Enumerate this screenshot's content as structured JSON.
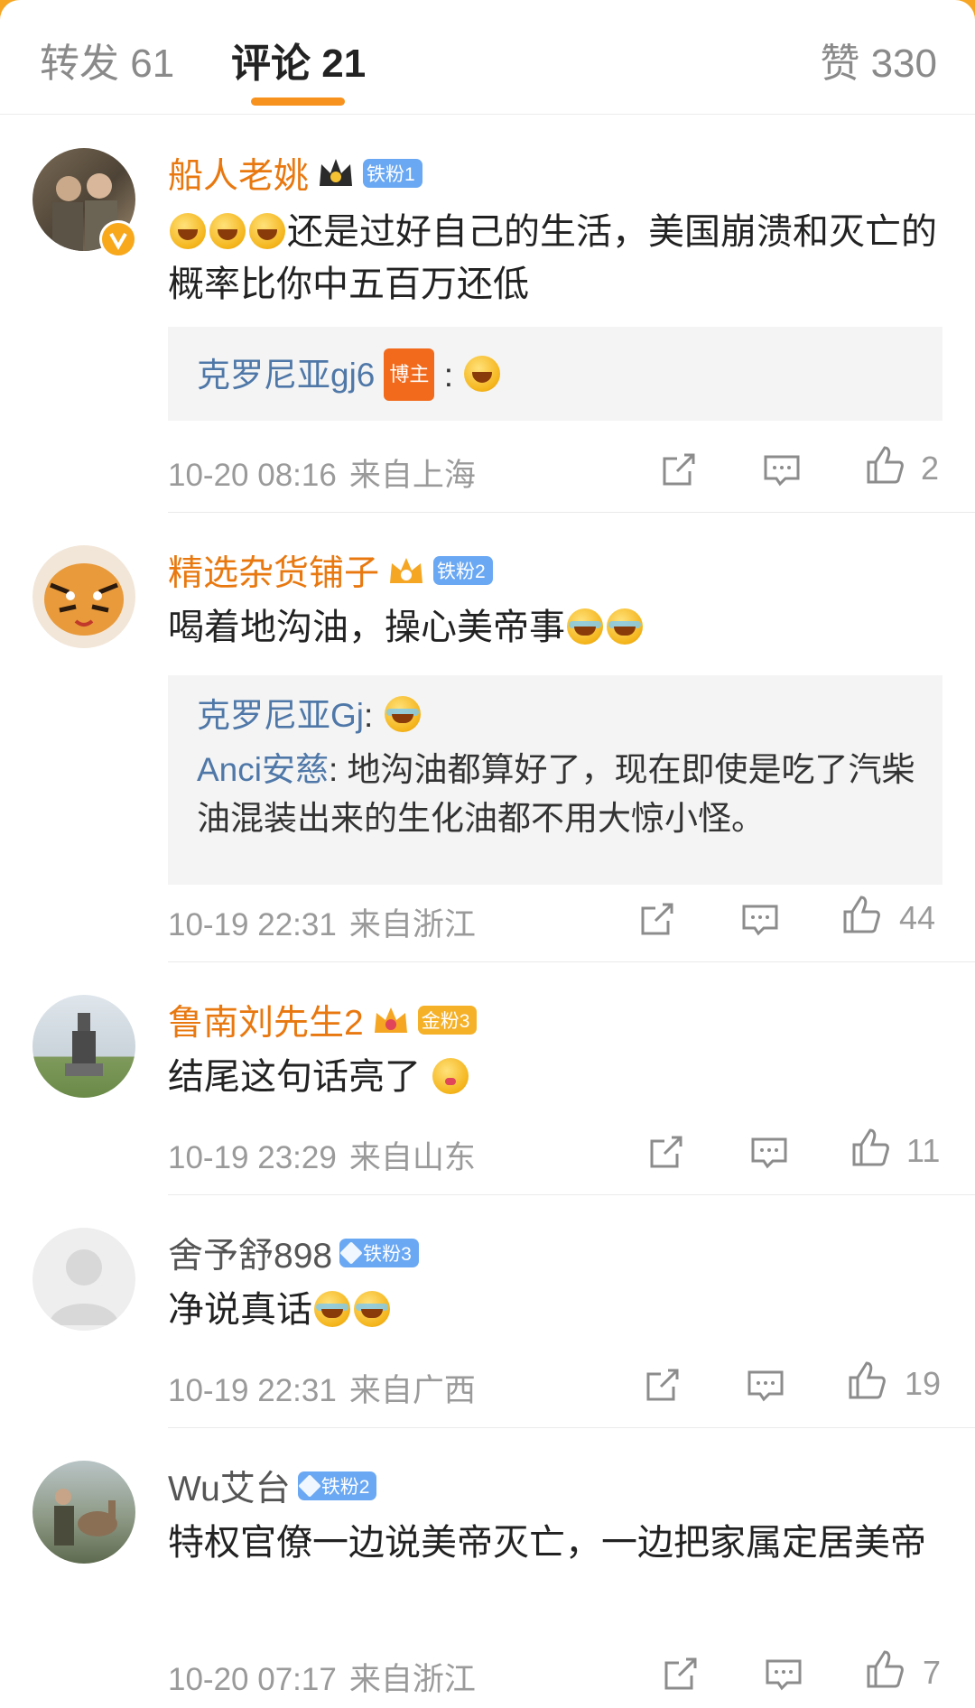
{
  "tabs": {
    "repost": "转发 61",
    "comments": "评论 21",
    "likes": "赞 330"
  },
  "colors": {
    "accent": "#f7921e",
    "username_fan": "#e8780f",
    "reply_user": "#4f78a8",
    "badge_blue": "#6aa8f3",
    "badge_gold": "#f5b128",
    "host_badge": "#f26a1b"
  },
  "comments": [
    {
      "name": "船人老姚",
      "badge": "铁粉1",
      "text": "还是过好自己的生活，美国崩溃和灭亡的概率比你中五百万还低",
      "reply": {
        "user": "克罗尼亚gj6",
        "tag": "博主",
        "text": ":"
      },
      "time": "10-20 08:16",
      "location": "来自上海",
      "likes": "2"
    },
    {
      "name": "精选杂货铺子",
      "badge": "铁粉2",
      "text": "喝着地沟油，操心美帝事",
      "replies": [
        {
          "user": "克罗尼亚Gj",
          "text": ":"
        },
        {
          "user": "Anci安慈",
          "text": ": 地沟油都算好了，现在即使是吃了汽柴油混装出来的生化油都不用大惊小怪。"
        }
      ],
      "time": "10-19 22:31",
      "location": "来自浙江",
      "likes": "44"
    },
    {
      "name": "鲁南刘先生2",
      "badge": "金粉3",
      "text": "结尾这句话亮了",
      "time": "10-19 23:29",
      "location": "来自山东",
      "likes": "11"
    },
    {
      "name": "舍予舒898",
      "badge": "铁粉3",
      "text": "净说真话",
      "time": "10-19 22:31",
      "location": "来自广西",
      "likes": "19"
    },
    {
      "name": "Wu艾台",
      "badge": "铁粉2",
      "text": "特权官僚一边说美帝灭亡，一边把家属定居美帝",
      "time": "10-20 07:17",
      "location": "来自浙江",
      "likes": "7"
    }
  ]
}
